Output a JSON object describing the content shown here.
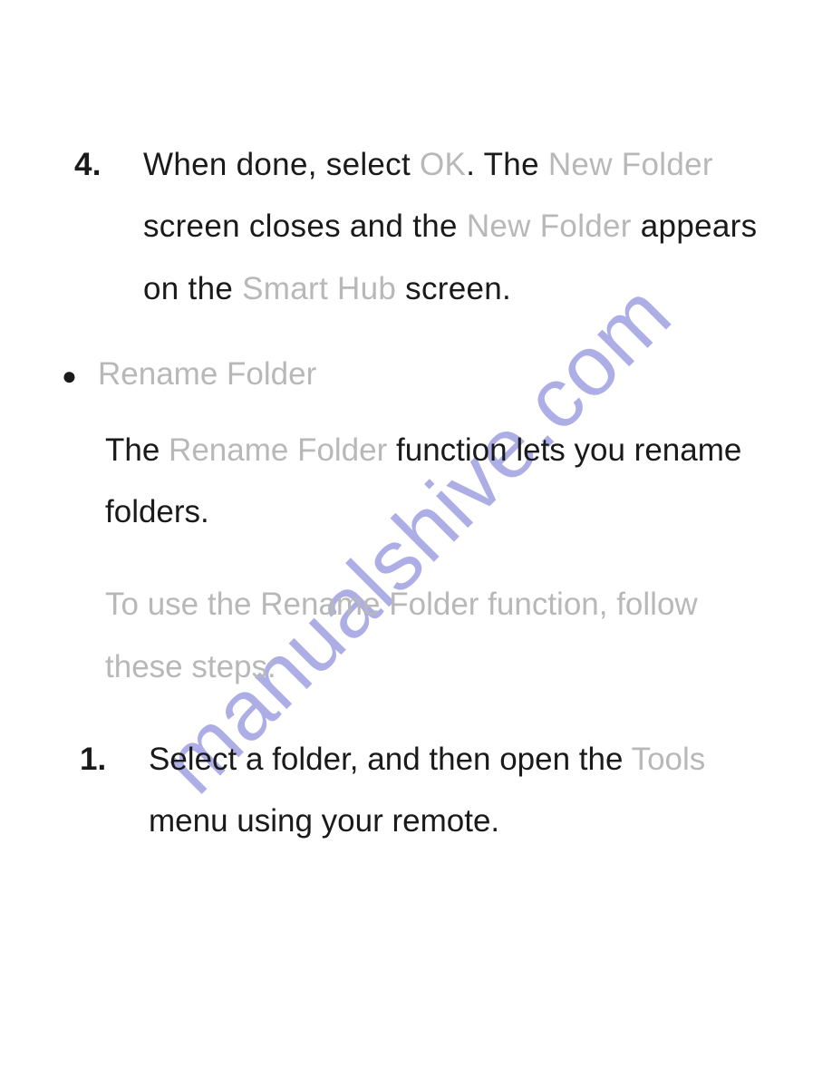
{
  "watermark": "manualshive.com",
  "step4": {
    "num": "4.",
    "t1": "When done, select ",
    "ok": "OK",
    "t2": ". The ",
    "nf1": "New Folder",
    "t3": " screen closes and the ",
    "nf2": "New Folder",
    "t4": " appears on the ",
    "sh": "Smart Hub",
    "t5": " screen."
  },
  "bullet": {
    "dot": "●",
    "title": "Rename Folder",
    "text_a": "The ",
    "text_rf": "Rename Folder",
    "text_b": " function lets you rename folders.",
    "instr": "To use the Rename Folder function, follow these steps:"
  },
  "step1": {
    "num": "1.",
    "t1": "Select a folder, and then open the ",
    "tools": "Tools",
    "t2": " menu using your remote."
  }
}
